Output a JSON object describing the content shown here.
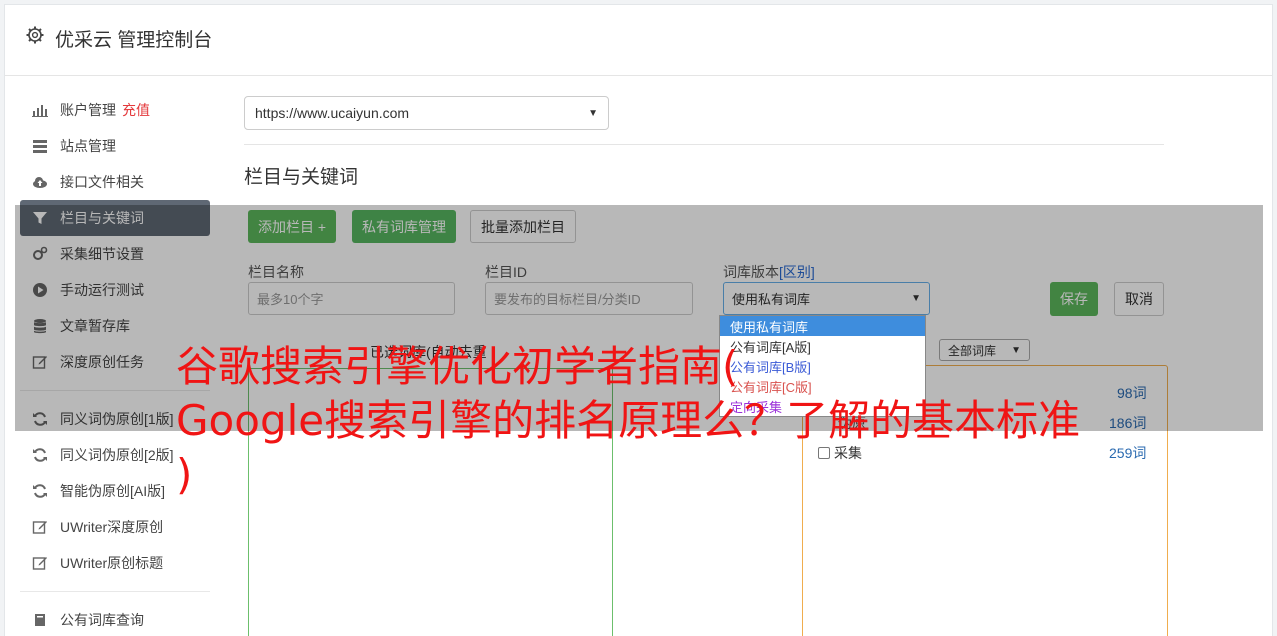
{
  "header": {
    "title": "优采云 管理控制台",
    "icon": "gear-icon"
  },
  "sidebar": {
    "items": [
      {
        "label": "账户管理",
        "badge": "充值",
        "icon": "bar-chart-icon"
      },
      {
        "label": "站点管理",
        "icon": "server-icon"
      },
      {
        "label": "接口文件相关",
        "icon": "cloud-upload-icon"
      },
      {
        "label": "栏目与关键词",
        "icon": "filter-icon",
        "active": true
      },
      {
        "label": "采集细节设置",
        "icon": "gears-icon"
      },
      {
        "label": "手动运行测试",
        "icon": "play-circle-icon"
      },
      {
        "label": "文章暂存库",
        "icon": "database-icon"
      },
      {
        "label": "深度原创任务",
        "icon": "edit-icon"
      },
      {
        "label": "同义词伪原创[1版]",
        "icon": "refresh-icon"
      },
      {
        "label": "同义词伪原创[2版]",
        "icon": "refresh-icon"
      },
      {
        "label": "智能伪原创[AI版]",
        "icon": "refresh-icon"
      },
      {
        "label": "UWriter深度原创",
        "icon": "edit-icon"
      },
      {
        "label": "UWriter原创标题",
        "icon": "edit-icon"
      },
      {
        "label": "公有词库查询",
        "icon": "book-icon"
      }
    ]
  },
  "main": {
    "site_select": "https://www.ucaiyun.com",
    "section_title": "栏目与关键词",
    "buttons": {
      "add_column": "添加栏目 +",
      "private_lib": "私有词库管理",
      "batch_add": "批量添加栏目",
      "save": "保存",
      "cancel": "取消"
    },
    "form": {
      "name_label": "栏目名称",
      "name_placeholder": "最多10个字",
      "id_label": "栏目ID",
      "id_placeholder": "要发布的目标栏目/分类ID",
      "lib_label": "词库版本",
      "lib_label_link": "[区别]",
      "lib_value": "使用私有词库"
    },
    "lib_options": [
      {
        "label": "使用私有词库",
        "color": "#ffffff"
      },
      {
        "label": "公有词库[A版]",
        "color": "#333333"
      },
      {
        "label": "公有词库[B版]",
        "color": "#3b5bd6"
      },
      {
        "label": "公有词库[C版]",
        "color": "#d9534f"
      },
      {
        "label": "定向采集",
        "color": "#9b30d9"
      }
    ],
    "selected_words_label": "已选词库(自动去重",
    "all_libs_select": "全部词库",
    "counts": [
      "98词",
      "186词",
      "259词"
    ],
    "collect_checkbox": "采集",
    "collect_partial": "伪原"
  },
  "overlay": {
    "line1": "谷歌搜索引擎优化初学者指南(",
    "line2": "Google搜索引擎的排名原理么？了解的基本标准",
    "line3": ")"
  }
}
